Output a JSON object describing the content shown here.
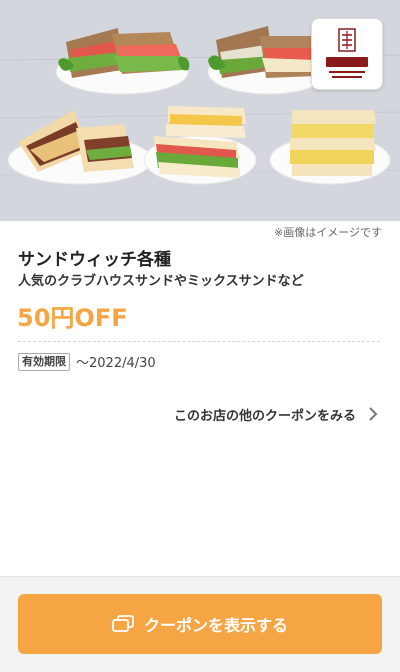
{
  "hero": {
    "image_caption": "※画像はイメージです",
    "logo_icon": "ueshima-coffee-logo-icon",
    "sandwiches": [
      "club-house-sandwich",
      "club-house-sandwich",
      "cutlet-sandwich",
      "egg-ham-sandwich",
      "egg-sandwich"
    ]
  },
  "coupon": {
    "title": "サンドウィッチ各種",
    "description": "人気のクラブハウスサンドやミックスサンドなど",
    "discount": "50円OFF",
    "validity_label": "有効期限",
    "validity_date": "〜2022/4/30"
  },
  "links": {
    "more_coupons": "このお店の他のクーポンをみる",
    "more_icon": "chevron-right-icon"
  },
  "actions": {
    "show_coupon": "クーポンを表示する",
    "show_coupon_icon": "coupon-cards-icon"
  },
  "colors": {
    "accent": "#f6a545",
    "bottom_bar": "#f2f2f2",
    "logo_red": "#8a1b1b"
  }
}
